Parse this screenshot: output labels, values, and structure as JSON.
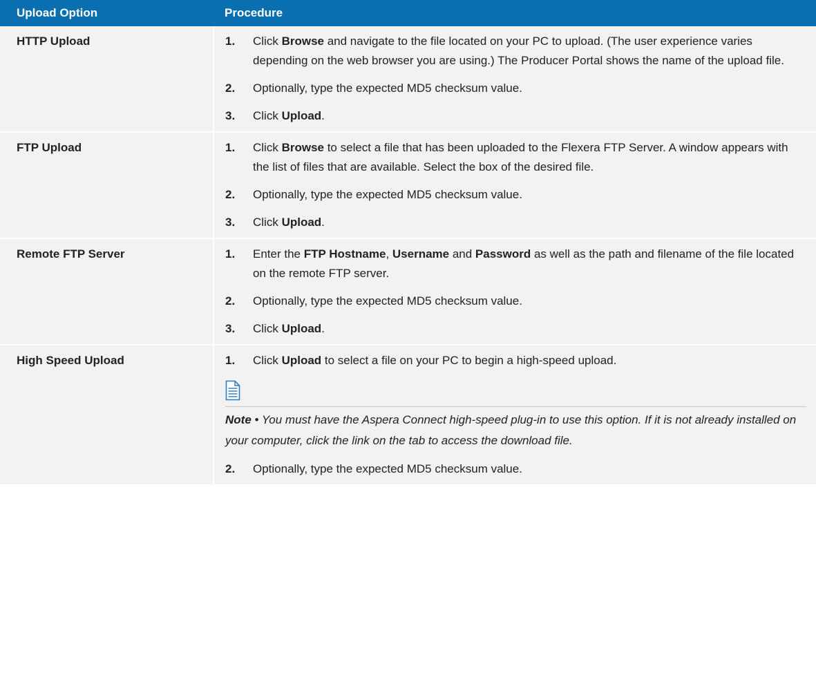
{
  "table": {
    "headers": [
      "Upload Option",
      "Procedure"
    ],
    "rows": [
      {
        "option": "HTTP Upload",
        "steps": [
          {
            "num": "1.",
            "parts": [
              [
                "t",
                "Click "
              ],
              [
                "b",
                "Browse"
              ],
              [
                "t",
                " and navigate to the file located on your PC to upload. (The user experience varies depending on the web browser you are using.) The Producer Portal shows the name of the upload file."
              ]
            ]
          },
          {
            "num": "2.",
            "parts": [
              [
                "t",
                "Optionally, type the expected MD5 checksum value."
              ]
            ]
          },
          {
            "num": "3.",
            "parts": [
              [
                "t",
                "Click "
              ],
              [
                "b",
                "Upload"
              ],
              [
                "t",
                "."
              ]
            ]
          }
        ]
      },
      {
        "option": "FTP Upload",
        "steps": [
          {
            "num": "1.",
            "parts": [
              [
                "t",
                "Click "
              ],
              [
                "b",
                "Browse"
              ],
              [
                "t",
                " to select a file that has been uploaded to the Flexera FTP Server. A window appears with the list of files that are available. Select the box of the desired file."
              ]
            ]
          },
          {
            "num": "2.",
            "parts": [
              [
                "t",
                "Optionally, type the expected MD5 checksum value."
              ]
            ]
          },
          {
            "num": "3.",
            "parts": [
              [
                "t",
                "Click "
              ],
              [
                "b",
                "Upload"
              ],
              [
                "t",
                "."
              ]
            ]
          }
        ]
      },
      {
        "option": "Remote FTP Server",
        "steps": [
          {
            "num": "1.",
            "parts": [
              [
                "t",
                "Enter the "
              ],
              [
                "b",
                "FTP Hostname"
              ],
              [
                "t",
                ", "
              ],
              [
                "b",
                "Username"
              ],
              [
                "t",
                " and "
              ],
              [
                "b",
                "Password"
              ],
              [
                "t",
                " as well as the path and filename of the file located on the remote FTP server."
              ]
            ]
          },
          {
            "num": "2.",
            "parts": [
              [
                "t",
                "Optionally, type the expected MD5 checksum value."
              ]
            ]
          },
          {
            "num": "3.",
            "parts": [
              [
                "t",
                "Click "
              ],
              [
                "b",
                "Upload"
              ],
              [
                "t",
                "."
              ]
            ]
          }
        ]
      },
      {
        "option": "High Speed Upload",
        "steps": [
          {
            "num": "1.",
            "parts": [
              [
                "t",
                "Click "
              ],
              [
                "b",
                "Upload"
              ],
              [
                "t",
                " to select a file on your PC to begin a high-speed upload."
              ]
            ]
          },
          {
            "note": {
              "icon": "note-document-icon",
              "label": "Note",
              "separator": " • ",
              "text": "You must have the Aspera Connect high-speed plug-in to use this option. If it is not already installed on your computer, click the link on the tab to access the download file."
            }
          },
          {
            "num": "2.",
            "parts": [
              [
                "t",
                "Optionally, type the expected MD5 checksum value."
              ]
            ]
          }
        ]
      }
    ]
  },
  "colors": {
    "header_bg": "#0a6fae",
    "header_text": "#ffffff",
    "row_bg": "#f2f2f2",
    "note_icon": "#2a7bbf"
  }
}
